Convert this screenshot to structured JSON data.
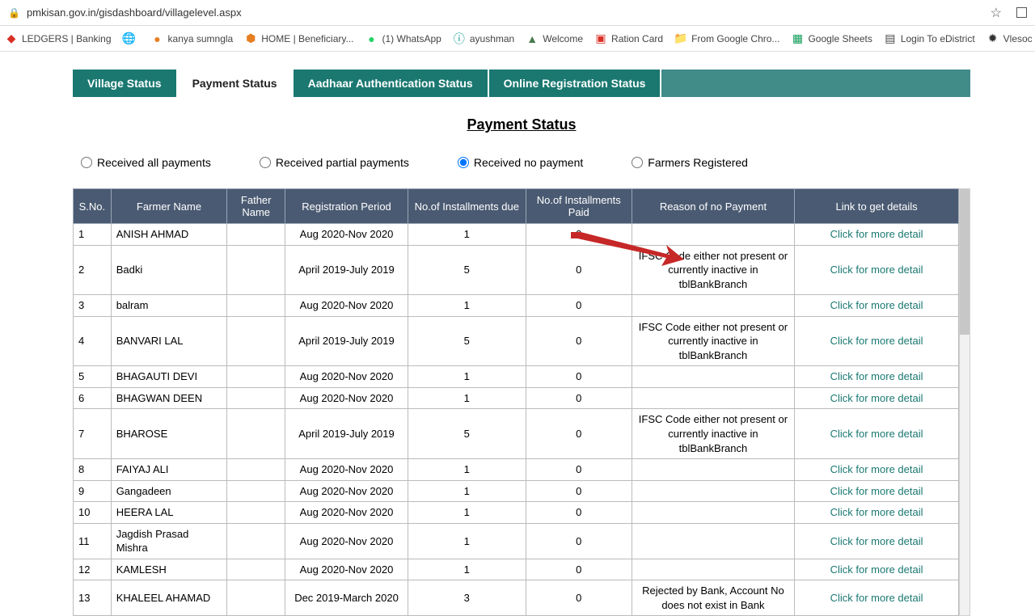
{
  "browser": {
    "url": "pmkisan.gov.in/gisdashboard/villagelevel.aspx"
  },
  "bookmarks": [
    "LEDGERS | Banking",
    "",
    "kanya sumngla",
    "HOME | Beneficiary...",
    "(1) WhatsApp",
    "ayushman",
    "Welcome",
    "Ration Card",
    "From Google Chro...",
    "Google Sheets",
    "Login To eDistrict",
    "Vlesoc"
  ],
  "tabs": [
    "Village Status",
    "Payment Status",
    "Aadhaar Authentication Status",
    "Online Registration Status"
  ],
  "page_title": "Payment Status",
  "filters": {
    "all": "Received all payments",
    "partial": "Received partial payments",
    "none": "Received no payment",
    "registered": "Farmers Registered"
  },
  "table": {
    "headers": {
      "sno": "S.No.",
      "farmer": "Farmer Name",
      "father": "Father Name",
      "reg": "Registration Period",
      "due": "No.of Installments due",
      "paid": "No.of Installments Paid",
      "reason": "Reason of no Payment",
      "link": "Link to get details"
    },
    "link_label": "Click for more detail",
    "rows": [
      {
        "sno": "1",
        "farmer": "ANISH AHMAD",
        "father": "",
        "reg": "Aug 2020-Nov 2020",
        "due": "1",
        "paid": "0",
        "reason": ""
      },
      {
        "sno": "2",
        "farmer": "Badki",
        "father": "",
        "reg": "April 2019-July 2019",
        "due": "5",
        "paid": "0",
        "reason": "IFSC Code either not present or currently inactive in tblBankBranch"
      },
      {
        "sno": "3",
        "farmer": "balram",
        "father": "",
        "reg": "Aug 2020-Nov 2020",
        "due": "1",
        "paid": "0",
        "reason": ""
      },
      {
        "sno": "4",
        "farmer": "BANVARI LAL",
        "father": "",
        "reg": "April 2019-July 2019",
        "due": "5",
        "paid": "0",
        "reason": "IFSC Code either not present or currently inactive in tblBankBranch"
      },
      {
        "sno": "5",
        "farmer": "BHAGAUTI DEVI",
        "father": "",
        "reg": "Aug 2020-Nov 2020",
        "due": "1",
        "paid": "0",
        "reason": ""
      },
      {
        "sno": "6",
        "farmer": "BHAGWAN DEEN",
        "father": "",
        "reg": "Aug 2020-Nov 2020",
        "due": "1",
        "paid": "0",
        "reason": ""
      },
      {
        "sno": "7",
        "farmer": "BHAROSE",
        "father": "",
        "reg": "April 2019-July 2019",
        "due": "5",
        "paid": "0",
        "reason": "IFSC Code either not present or currently inactive in tblBankBranch"
      },
      {
        "sno": "8",
        "farmer": "FAIYAJ ALI",
        "father": "",
        "reg": "Aug 2020-Nov 2020",
        "due": "1",
        "paid": "0",
        "reason": ""
      },
      {
        "sno": "9",
        "farmer": "Gangadeen",
        "father": "",
        "reg": "Aug 2020-Nov 2020",
        "due": "1",
        "paid": "0",
        "reason": ""
      },
      {
        "sno": "10",
        "farmer": "HEERA LAL",
        "father": "",
        "reg": "Aug 2020-Nov 2020",
        "due": "1",
        "paid": "0",
        "reason": ""
      },
      {
        "sno": "11",
        "farmer": "Jagdish Prasad Mishra",
        "father": "",
        "reg": "Aug 2020-Nov 2020",
        "due": "1",
        "paid": "0",
        "reason": ""
      },
      {
        "sno": "12",
        "farmer": "KAMLESH",
        "father": "",
        "reg": "Aug 2020-Nov 2020",
        "due": "1",
        "paid": "0",
        "reason": ""
      },
      {
        "sno": "13",
        "farmer": "KHALEEL AHAMAD",
        "father": "",
        "reg": "Dec 2019-March 2020",
        "due": "3",
        "paid": "0",
        "reason": "Rejected by Bank, Account No does not exist in Bank"
      }
    ]
  }
}
